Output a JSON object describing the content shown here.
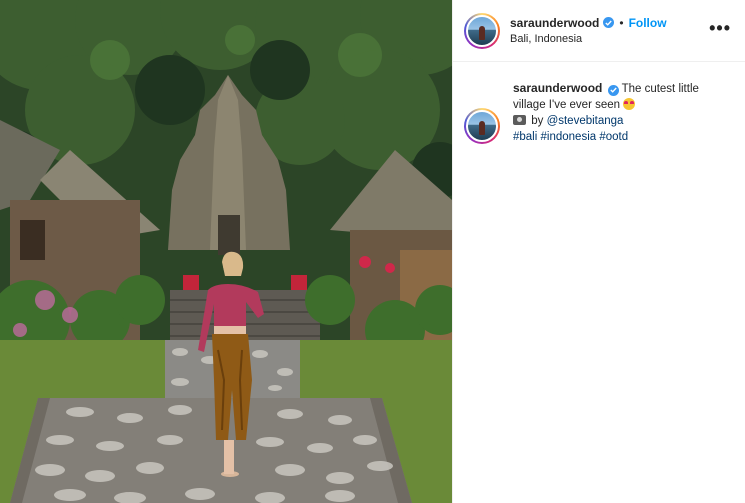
{
  "post": {
    "image_alt": "Woman in a red patterned top and bronze velvet flared trousers walking down stone steps in front of a Balinese temple gate surrounded by jungle"
  },
  "header": {
    "username": "saraunderwood",
    "separator": "•",
    "follow_label": "Follow",
    "location": "Bali, Indonesia",
    "more_label": "•••"
  },
  "caption": {
    "username": "saraunderwood",
    "text": "The cutest little village I've ever seen",
    "credit_prefix": "by",
    "credit_handle": "@stevebitanga",
    "hashtags": [
      "#bali",
      "#indonesia",
      "#ootd"
    ]
  },
  "icons": {
    "verified": "verified-badge-icon",
    "more": "more-options-icon",
    "camera": "camera-emoji",
    "face": "heart-eyes-emoji"
  },
  "colors": {
    "accent": "#0095f6",
    "tag": "#00376b",
    "verified": "#3897f0"
  }
}
